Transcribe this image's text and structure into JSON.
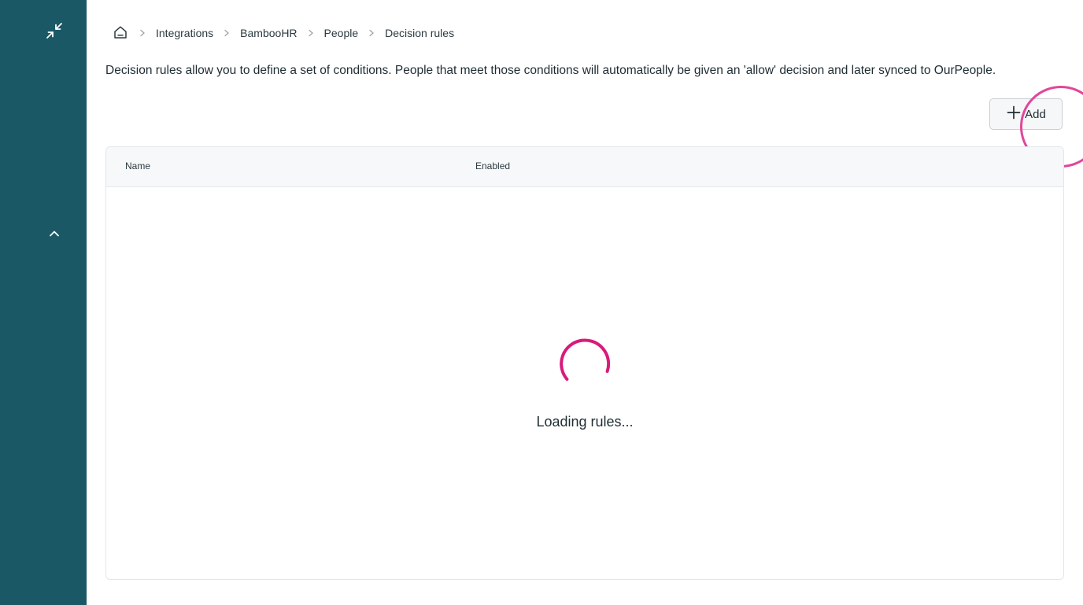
{
  "sidebar": {
    "collapse_icon": "collapse-arrows-icon",
    "chevron_icon": "chevron-up-icon",
    "background": "#1a5866"
  },
  "breadcrumb": {
    "home_icon": "home-icon",
    "items": [
      "Integrations",
      "BambooHR",
      "People",
      "Decision rules"
    ]
  },
  "description": "Decision rules allow you to define a set of conditions. People that meet those conditions will automatically be given an 'allow' decision and later synced to OurPeople.",
  "toolbar": {
    "add_label": "Add",
    "add_icon": "plus-icon"
  },
  "table": {
    "columns": [
      "Name",
      "Enabled"
    ]
  },
  "loading": {
    "text": "Loading rules...",
    "spinner_color": "#d81b7a"
  },
  "colors": {
    "accent": "#d81b7a",
    "sidebar": "#1a5866"
  }
}
